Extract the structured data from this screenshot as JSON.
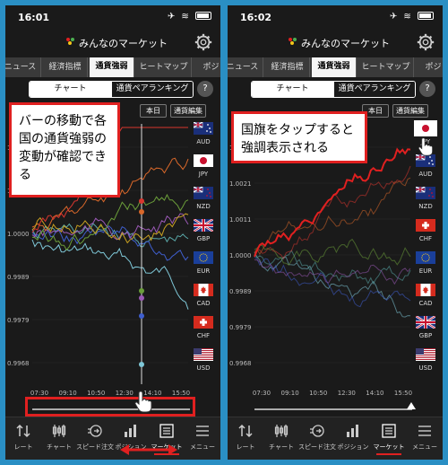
{
  "screens": [
    {
      "time": "16:01",
      "app_title": "みんなのマーケット",
      "tabs": [
        "ニュース",
        "経済指標",
        "通貨強弱",
        "ヒートマップ",
        "ポジ"
      ],
      "active_tab": 2,
      "segments": [
        "チャート",
        "通貨ペアランキング"
      ],
      "help_label": "?",
      "btn_today": "本日",
      "btn_edit": "通貨編集",
      "y_ticks": [
        "1.0021",
        "1.0011",
        "1.0000",
        "0.9989",
        "0.9979",
        "0.9968"
      ],
      "x_ticks": [
        "07:30",
        "09:10",
        "10:50",
        "12:30",
        "14:10",
        "15:50"
      ],
      "flags": [
        "AUD",
        "JPY",
        "NZD",
        "GBP",
        "EUR",
        "CAD",
        "CHF",
        "USD"
      ],
      "callout_lines": [
        "バーの移動で各",
        "国の通貨強弱の",
        "変動が確認できる"
      ],
      "nav": [
        "レート",
        "チャート",
        "スピード注文",
        "ポジション",
        "マーケット",
        "メニュー"
      ],
      "active_nav": 4
    },
    {
      "time": "16:02",
      "app_title": "みんなのマーケット",
      "tabs": [
        "ニュース",
        "経済指標",
        "通貨強弱",
        "ヒートマップ",
        "ポジ"
      ],
      "active_tab": 2,
      "segments": [
        "チャート",
        "通貨ペアランキング"
      ],
      "help_label": "?",
      "btn_today": "本日",
      "btn_edit": "通貨編集",
      "y_ticks": [
        "1.0032",
        "1.0021",
        "1.0011",
        "1.0000",
        "0.9989",
        "0.9979",
        "0.9968"
      ],
      "x_ticks": [
        "07:30",
        "09:10",
        "10:50",
        "12:30",
        "14:10",
        "15:50"
      ],
      "flags": [
        "JPY",
        "AUD",
        "NZD",
        "CHF",
        "EUR",
        "CAD",
        "GBP",
        "USD"
      ],
      "callout_lines": [
        "国旗をタップすると",
        "強調表示される"
      ],
      "nav": [
        "レート",
        "チャート",
        "スピード注文",
        "ポジション",
        "マーケット",
        "メニュー"
      ],
      "active_nav": 4
    }
  ],
  "colors": {
    "AUD": "#d8362f",
    "JPY": "#c8a020",
    "NZD": "#d9682a",
    "GBP": "#6b9e3a",
    "EUR": "#9b59b6",
    "CAD": "#3f5fcf",
    "CHF": "#5aa8a8",
    "USD": "#7fc8d8",
    "highlight": "#e02020",
    "background": "#2a8fc4"
  }
}
